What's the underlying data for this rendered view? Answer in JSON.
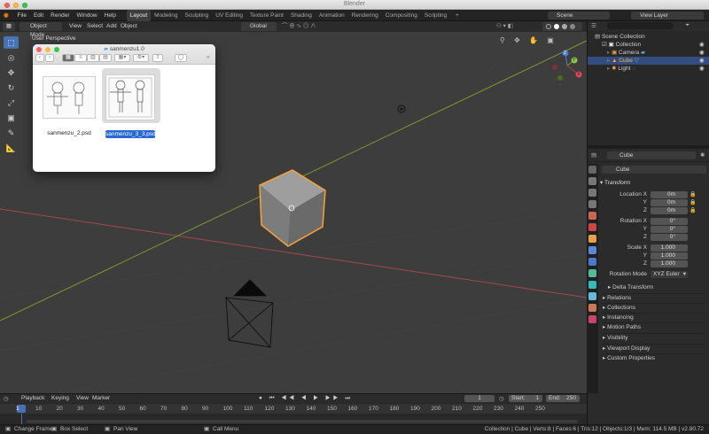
{
  "window": {
    "title": "Blender"
  },
  "topbar": {
    "menus": [
      "File",
      "Edit",
      "Render",
      "Window",
      "Help"
    ],
    "workspaces": [
      "Layout",
      "Modeling",
      "Sculpting",
      "UV Editing",
      "Texture Paint",
      "Shading",
      "Animation",
      "Rendering",
      "Compositing",
      "Scripting"
    ],
    "scene": "Scene",
    "view_layer": "View Layer"
  },
  "viewport_header": {
    "mode": "Object Mode",
    "menus": [
      "View",
      "Select",
      "Add",
      "Object"
    ],
    "orientation": "Global"
  },
  "viewport": {
    "perspective_label": "User Perspective"
  },
  "gizmo": {
    "x": "X",
    "y": "Y",
    "z": "Z"
  },
  "finder": {
    "folder": "sanmenzu1.0",
    "files": [
      {
        "name": "sanmenzu_2.psd",
        "selected": false
      },
      {
        "name": "sanmenzu_3_3.psd",
        "selected": true
      }
    ]
  },
  "outliner": {
    "title": "Scene Collection",
    "items": [
      {
        "label": "Collection",
        "indent": 1
      },
      {
        "label": "Camera",
        "indent": 2
      },
      {
        "label": "Cube",
        "indent": 2
      },
      {
        "label": "Light",
        "indent": 2
      }
    ]
  },
  "properties": {
    "object_name": "Cube",
    "mesh_name": "Cube",
    "transform_label": "Transform",
    "rows": [
      {
        "label": "Location X",
        "value": "0m"
      },
      {
        "label": "Y",
        "value": "0m"
      },
      {
        "label": "Z",
        "value": "0m"
      },
      {
        "label": "Rotation X",
        "value": "0°"
      },
      {
        "label": "Y",
        "value": "0°"
      },
      {
        "label": "Z",
        "value": "0°"
      },
      {
        "label": "Scale X",
        "value": "1.000"
      },
      {
        "label": "Y",
        "value": "1.000"
      },
      {
        "label": "Z",
        "value": "1.000"
      }
    ],
    "rotation_mode_label": "Rotation Mode",
    "rotation_mode": "XYZ Euler",
    "delta": "Delta Transform",
    "panels": [
      "Relations",
      "Collections",
      "Instancing",
      "Motion Paths",
      "Visibility",
      "Viewport Display",
      "Custom Properties"
    ]
  },
  "timeline": {
    "menus": [
      "Playback",
      "Keying",
      "View",
      "Marker"
    ],
    "current_frame": "1",
    "start_label": "Start:",
    "start": "1",
    "end_label": "End:",
    "end": "250",
    "ticks": [
      "1",
      "10",
      "20",
      "30",
      "40",
      "50",
      "60",
      "70",
      "80",
      "90",
      "100",
      "110",
      "120",
      "130",
      "140",
      "150",
      "160",
      "170",
      "180",
      "190",
      "200",
      "210",
      "220",
      "230",
      "240",
      "250"
    ]
  },
  "status": {
    "hints": [
      "Change Frame",
      "Box Select",
      "Pan View",
      "Call Menu"
    ],
    "info": "Collection | Cube | Verts:8 | Faces:6 | Tris:12 | Objects:1/3 | Mem: 114.5 MB | v2.80.72"
  },
  "colors": {
    "accent": "#4772b3",
    "selection": "#f4a534",
    "x_axis": "#a3484e",
    "y_axis": "#7d9a2a"
  }
}
